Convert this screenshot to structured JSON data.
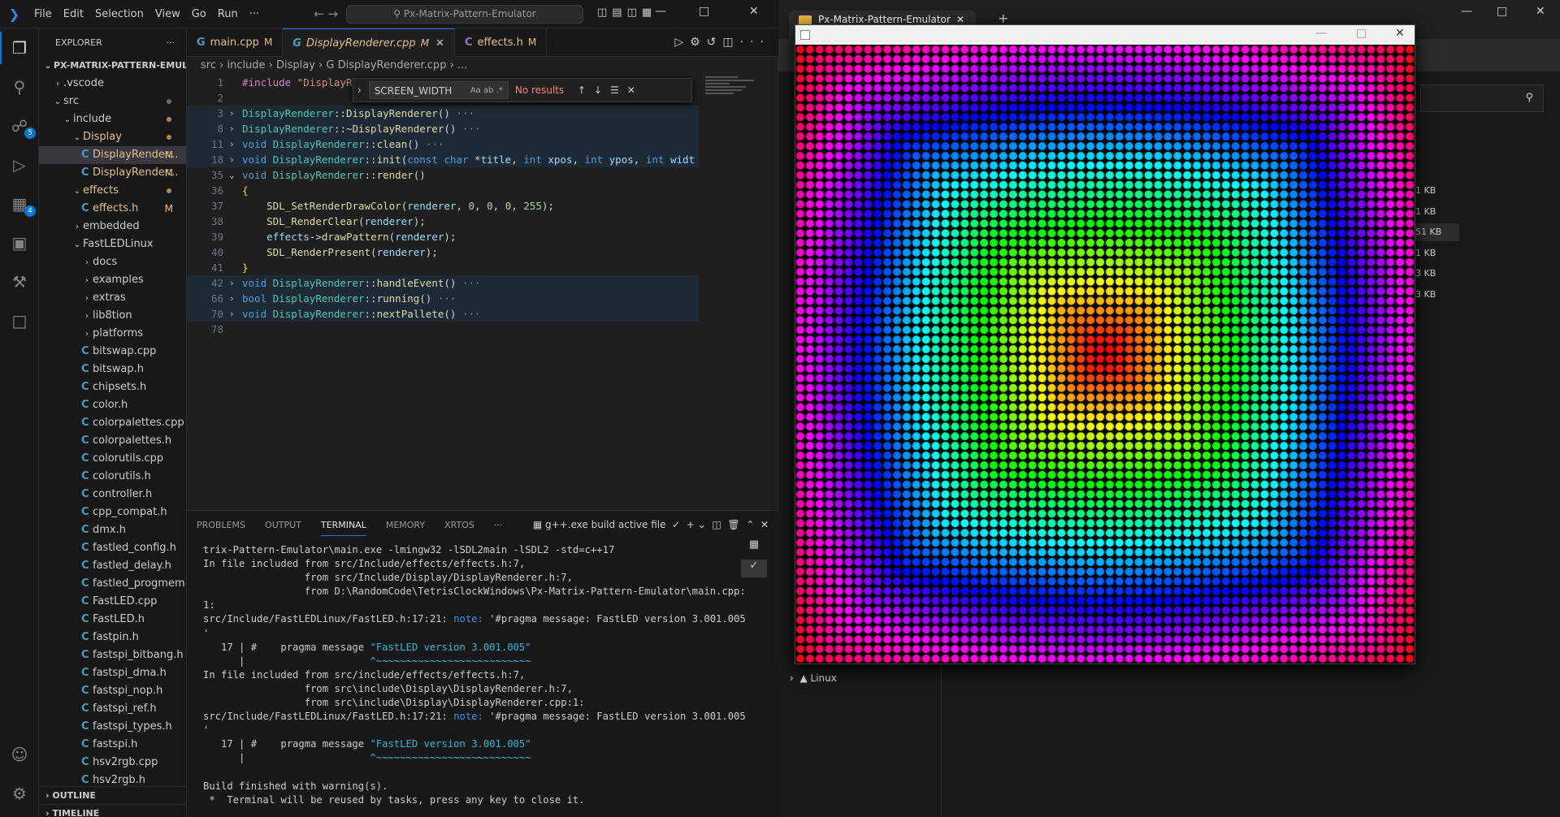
{
  "vscode": {
    "menu": [
      "File",
      "Edit",
      "Selection",
      "View",
      "Go",
      "Run",
      "···"
    ],
    "search_text": "Px-Matrix-Pattern-Emulator",
    "win_controls": [
      "—",
      "□",
      "✕"
    ],
    "activity": {
      "scm_badge": "5",
      "ext_badge": "4"
    },
    "explorer": {
      "header": "EXPLORER",
      "root": "PX-MATRIX-PATTERN-EMUL...",
      "items": [
        {
          "label": ".vscode",
          "indent": 1,
          "chev": "›",
          "dot": ""
        },
        {
          "label": "src",
          "indent": 1,
          "chev": "⌄",
          "dot": "g"
        },
        {
          "label": "include",
          "indent": 2,
          "chev": "⌄",
          "dot": "y"
        },
        {
          "label": "Display",
          "indent": 3,
          "chev": "⌄",
          "dot": "y",
          "yellow": true
        },
        {
          "label": "DisplayRender...",
          "indent": 4,
          "file": true,
          "mark": "M",
          "sel": true,
          "yellow": true
        },
        {
          "label": "DisplayRender...",
          "indent": 4,
          "file": true,
          "mark": "M",
          "yellow": true
        },
        {
          "label": "effects",
          "indent": 3,
          "chev": "⌄",
          "dot": "y",
          "yellow": true
        },
        {
          "label": "effects.h",
          "indent": 4,
          "file": true,
          "mark": "M",
          "yellow": true
        },
        {
          "label": "embedded",
          "indent": 3,
          "chev": "›"
        },
        {
          "label": "FastLEDLinux",
          "indent": 3,
          "chev": "⌄"
        },
        {
          "label": "docs",
          "indent": 4,
          "chev": "›"
        },
        {
          "label": "examples",
          "indent": 4,
          "chev": "›"
        },
        {
          "label": "extras",
          "indent": 4,
          "chev": "›"
        },
        {
          "label": "lib8tion",
          "indent": 4,
          "chev": "›"
        },
        {
          "label": "platforms",
          "indent": 4,
          "chev": "›"
        },
        {
          "label": "bitswap.cpp",
          "indent": 4,
          "file": true
        },
        {
          "label": "bitswap.h",
          "indent": 4,
          "file": true
        },
        {
          "label": "chipsets.h",
          "indent": 4,
          "file": true
        },
        {
          "label": "color.h",
          "indent": 4,
          "file": true
        },
        {
          "label": "colorpalettes.cpp",
          "indent": 4,
          "file": true
        },
        {
          "label": "colorpalettes.h",
          "indent": 4,
          "file": true
        },
        {
          "label": "colorutils.cpp",
          "indent": 4,
          "file": true
        },
        {
          "label": "colorutils.h",
          "indent": 4,
          "file": true
        },
        {
          "label": "controller.h",
          "indent": 4,
          "file": true
        },
        {
          "label": "cpp_compat.h",
          "indent": 4,
          "file": true
        },
        {
          "label": "dmx.h",
          "indent": 4,
          "file": true
        },
        {
          "label": "fastled_config.h",
          "indent": 4,
          "file": true
        },
        {
          "label": "fastled_delay.h",
          "indent": 4,
          "file": true
        },
        {
          "label": "fastled_progmem.h",
          "indent": 4,
          "file": true
        },
        {
          "label": "FastLED.cpp",
          "indent": 4,
          "file": true
        },
        {
          "label": "FastLED.h",
          "indent": 4,
          "file": true
        },
        {
          "label": "fastpin.h",
          "indent": 4,
          "file": true
        },
        {
          "label": "fastspi_bitbang.h",
          "indent": 4,
          "file": true
        },
        {
          "label": "fastspi_dma.h",
          "indent": 4,
          "file": true
        },
        {
          "label": "fastspi_nop.h",
          "indent": 4,
          "file": true
        },
        {
          "label": "fastspi_ref.h",
          "indent": 4,
          "file": true
        },
        {
          "label": "fastspi_types.h",
          "indent": 4,
          "file": true
        },
        {
          "label": "fastspi.h",
          "indent": 4,
          "file": true
        },
        {
          "label": "hsv2rgb.cpp",
          "indent": 4,
          "file": true
        },
        {
          "label": "hsv2rgb.h",
          "indent": 4,
          "file": true
        }
      ],
      "outline": "OUTLINE",
      "timeline": "TIMELINE"
    },
    "tabs": [
      {
        "label": "main.cpp",
        "mark": "M",
        "icon": "G"
      },
      {
        "label": "DisplayRenderer.cpp",
        "mark": "M",
        "icon": "G",
        "active": true
      },
      {
        "label": "effects.h",
        "mark": "M",
        "icon": "C"
      }
    ],
    "breadcrumb": "src › include › Display ›  G DisplayRenderer.cpp › ...",
    "find": {
      "value": "SCREEN_WIDTH",
      "result": "No results",
      "opts": "Aa  ab  .*"
    },
    "code": [
      {
        "n": "1",
        "fold": "",
        "html": "<span class='pp'>#include</span> <span class='st'>\"DisplayRenderer.h\"</span>"
      },
      {
        "n": "2",
        "fold": "",
        "html": ""
      },
      {
        "n": "3",
        "fold": "›",
        "hl": true,
        "html": "<span class='tp'>DisplayRenderer</span>::<span class='fn'>DisplayRenderer</span>() <span style='color:#888'>···</span>"
      },
      {
        "n": "8",
        "fold": "›",
        "hl": true,
        "html": "<span class='tp'>DisplayRenderer</span>::<span class='fn'>~DisplayRenderer</span>() <span style='color:#888'>···</span>"
      },
      {
        "n": "11",
        "fold": "›",
        "hl": true,
        "html": "<span class='kw'>void</span> <span class='tp'>DisplayRenderer</span>::<span class='fn'>clean</span>() <span style='color:#888'>···</span>"
      },
      {
        "n": "18",
        "fold": "›",
        "hl": true,
        "html": "<span class='kw'>void</span> <span class='tp'>DisplayRenderer</span>::<span class='fn'>init</span>(<span class='kw'>const char</span> *<span class='pr'>title</span>, <span class='kw'>int</span> <span class='pr'>xpos</span>, <span class='kw'>int</span> <span class='pr'>ypos</span>, <span class='kw'>int</span> <span class='pr'>widt</span>"
      },
      {
        "n": "35",
        "fold": "⌄",
        "html": "<span class='kw'>void</span> <span class='tp'>DisplayRenderer</span>::<span class='fn'>render</span>()"
      },
      {
        "n": "36",
        "fold": "",
        "html": "<span style='color:#ffd700'>{</span>"
      },
      {
        "n": "37",
        "fold": "",
        "html": "    <span class='fn'>SDL_SetRenderDrawColor</span>(<span class='pr'>renderer</span>, <span class='nu'>0</span>, <span class='nu'>0</span>, <span class='nu'>0</span>, <span class='nu'>255</span>);"
      },
      {
        "n": "38",
        "fold": "",
        "html": "    <span class='fn'>SDL_RenderClear</span>(<span class='pr'>renderer</span>);"
      },
      {
        "n": "39",
        "fold": "",
        "html": "    <span class='pr'>effects</span>-><span class='fn'>drawPattern</span>(<span class='pr'>renderer</span>);"
      },
      {
        "n": "40",
        "fold": "",
        "html": "    <span class='fn'>SDL_RenderPresent</span>(<span class='pr'>renderer</span>);"
      },
      {
        "n": "41",
        "fold": "",
        "html": "<span style='color:#ffd700'>}</span>"
      },
      {
        "n": "42",
        "fold": "›",
        "hl": true,
        "html": "<span class='kw'>void</span> <span class='tp'>DisplayRenderer</span>::<span class='fn'>handleEvent</span>() <span style='color:#888'>···</span>"
      },
      {
        "n": "66",
        "fold": "›",
        "hl": true,
        "html": "<span class='kw'>bool</span> <span class='tp'>DisplayRenderer</span>::<span class='fn'>running</span>() <span style='color:#888'>···</span>"
      },
      {
        "n": "70",
        "fold": "›",
        "hl": true,
        "html": "<span class='kw'>void</span> <span class='tp'>DisplayRenderer</span>::<span class='fn'>nextPallete</span>() <span style='color:#888'>···</span>"
      },
      {
        "n": "78",
        "fold": "",
        "html": ""
      }
    ],
    "panel": {
      "tabs": [
        "PROBLEMS",
        "OUTPUT",
        "TERMINAL",
        "MEMORY",
        "XRTOS",
        "···"
      ],
      "active": "TERMINAL",
      "task": "g++.exe build active file",
      "terminal": [
        "trix-Pattern-Emulator\\main.exe -lmingw32 -lSDL2main -lSDL2 -std=c++17",
        "In file included from src/Include/effects/effects.h:7,",
        "                 from src/Include/Display/DisplayRenderer.h:7,",
        "                 from D:\\RandomCode\\TetrisClockWindows\\Px-Matrix-Pattern-Emulator\\main.cpp:",
        "1:",
        "src/Include/FastLEDLinux/FastLED.h:17:21: note: '#pragma message: FastLED version 3.001.005",
        "'",
        "   17 | #    pragma message \"FastLED version 3.001.005\"",
        "      |                     ^~~~~~~~~~~~~~~~~~~~~~~~~~~",
        "In file included from src/include/effects/effects.h:7,",
        "                 from src\\include\\Display\\DisplayRenderer.h:7,",
        "                 from src\\include\\Display\\DisplayRenderer.cpp:1:",
        "src/Include/FastLEDLinux/FastLED.h:17:21: note: '#pragma message: FastLED version 3.001.005",
        "'",
        "   17 | #    pragma message \"FastLED version 3.001.005\"",
        "      |                     ^~~~~~~~~~~~~~~~~~~~~~~~~~~",
        "",
        "Build finished with warning(s).",
        " *  Terminal will be reused by tasks, press any key to close it."
      ]
    }
  },
  "explorer_window": {
    "tab_title": "Px-Matrix-Pattern-Emulator",
    "sizes": [
      "1 KB",
      "1 KB",
      "51 KB",
      "1 KB",
      "3 KB",
      "3 KB"
    ],
    "linux": "Linux"
  },
  "sdl_window": {
    "title": ""
  }
}
